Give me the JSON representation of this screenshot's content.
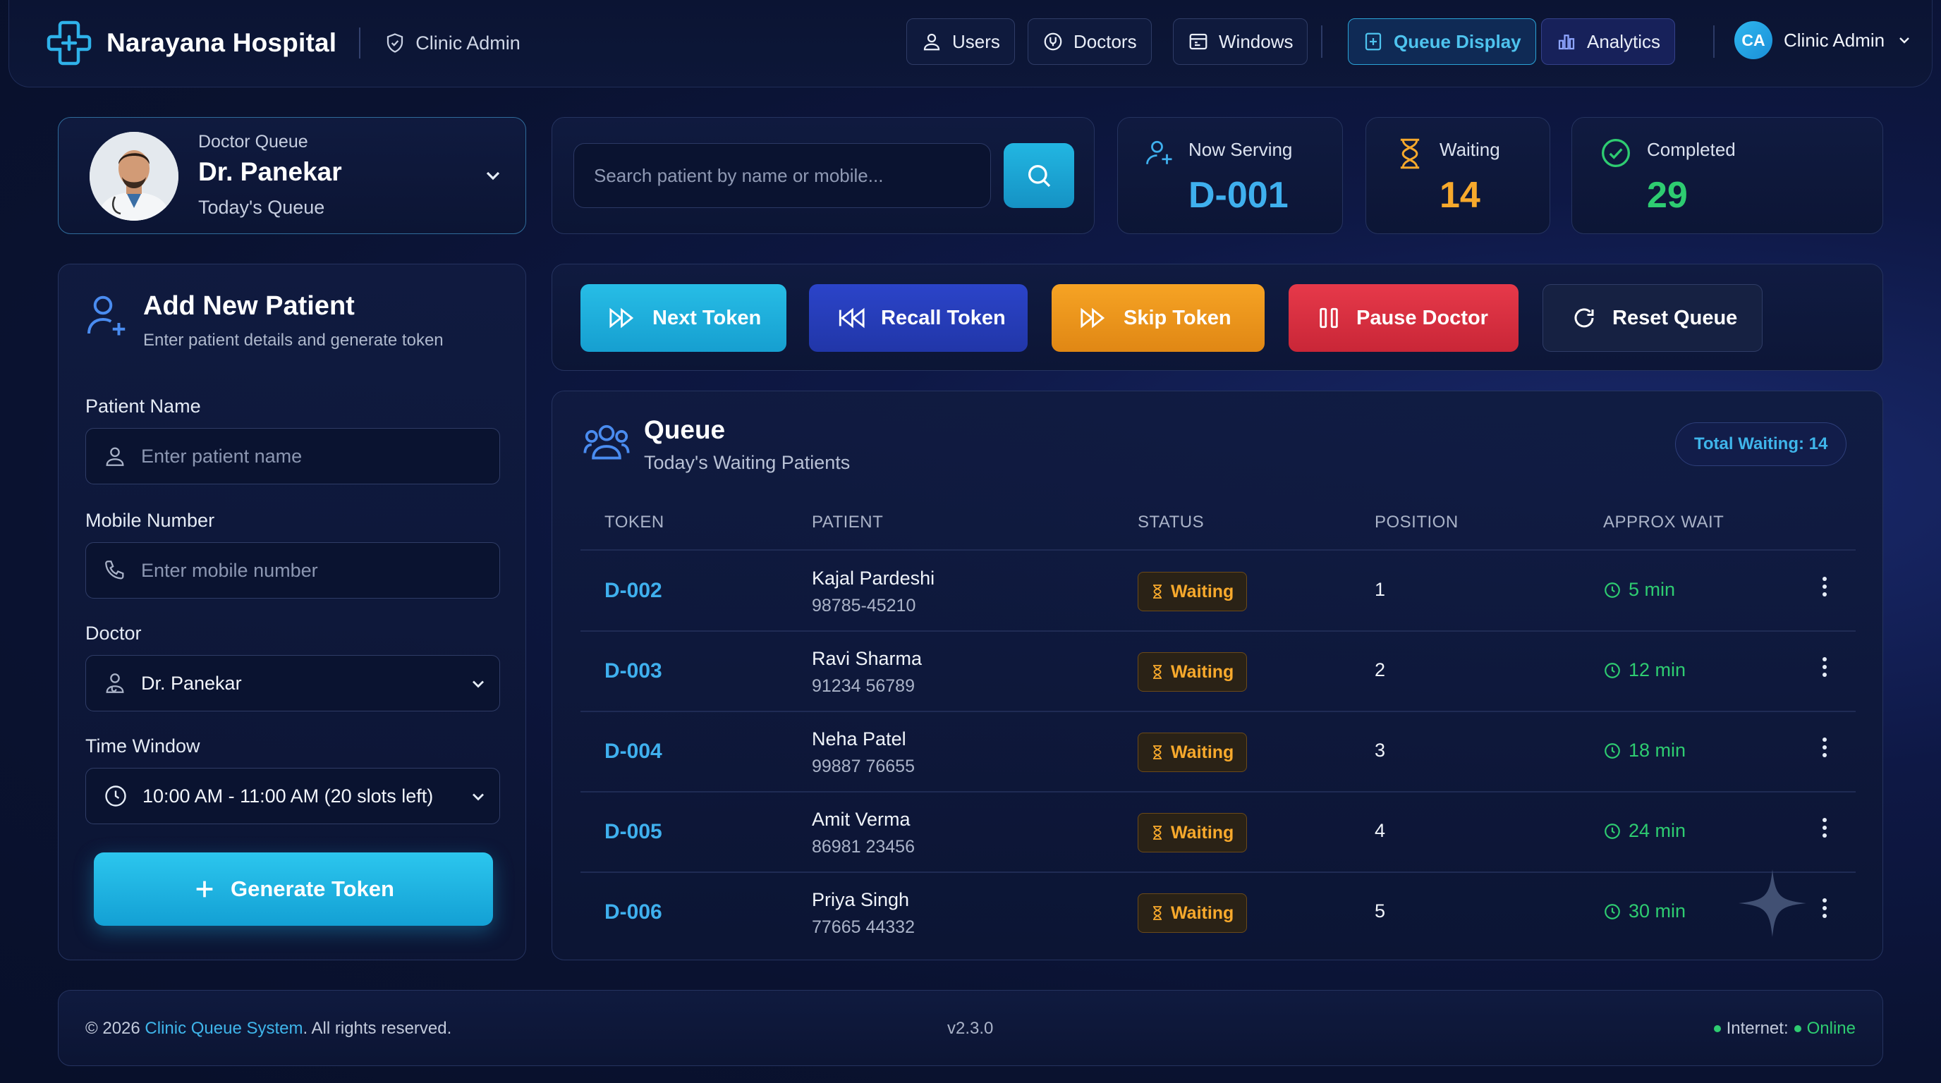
{
  "header": {
    "brand": "Narayana Hospital",
    "role": "Clinic Admin",
    "nav": [
      {
        "label": "Users",
        "icon": "user-icon"
      },
      {
        "label": "Doctors",
        "icon": "stethoscope-icon"
      },
      {
        "label": "Windows",
        "icon": "window-icon"
      },
      {
        "label": "Queue Display",
        "icon": "display-icon",
        "active": true
      },
      {
        "label": "Analytics",
        "icon": "bar-chart-icon"
      }
    ],
    "user": {
      "initials": "CA",
      "name": "Clinic Admin"
    }
  },
  "doctor_card": {
    "small": "Doctor Queue",
    "name": "Dr. Panekar",
    "sub": "Today's Queue"
  },
  "search": {
    "placeholder": "Search patient by name or mobile..."
  },
  "stats": {
    "now_serving": {
      "label": "Now Serving",
      "value": "D-001",
      "color": "#3fb0ee"
    },
    "waiting": {
      "label": "Waiting",
      "value": "14",
      "color": "#f7a92c"
    },
    "completed": {
      "label": "Completed",
      "value": "29",
      "color": "#2ecc71"
    }
  },
  "form": {
    "title": "Add New Patient",
    "subtitle": "Enter patient details and generate token",
    "name_label": "Patient Name",
    "name_placeholder": "Enter patient name",
    "mobile_label": "Mobile Number",
    "mobile_placeholder": "Enter mobile number",
    "doctor_label": "Doctor",
    "doctor_value": "Dr. Panekar",
    "time_label": "Time Window",
    "time_value": "10:00 AM - 11:00 AM (20 slots left)",
    "generate_label": "Generate Token"
  },
  "actions": {
    "next": "Next Token",
    "recall": "Recall Token",
    "skip": "Skip Token",
    "pause": "Pause Doctor",
    "reset": "Reset Queue"
  },
  "queue": {
    "title": "Queue",
    "subtitle": "Today's Waiting Patients",
    "total": "Total Waiting: 14",
    "headers": {
      "token": "TOKEN",
      "patient": "PATIENT",
      "status": "STATUS",
      "position": "POSITION",
      "wait": "APPROX WAIT"
    },
    "rows": [
      {
        "token": "D-002",
        "name": "Kajal Pardeshi",
        "mobile": "98785-45210",
        "status": "Waiting",
        "position": "1",
        "wait": "5 min"
      },
      {
        "token": "D-003",
        "name": "Ravi Sharma",
        "mobile": "91234 56789",
        "status": "Waiting",
        "position": "2",
        "wait": "12 min"
      },
      {
        "token": "D-004",
        "name": "Neha Patel",
        "mobile": "99887 76655",
        "status": "Waiting",
        "position": "3",
        "wait": "18 min"
      },
      {
        "token": "D-005",
        "name": "Amit Verma",
        "mobile": "86981 23456",
        "status": "Waiting",
        "position": "4",
        "wait": "24 min"
      },
      {
        "token": "D-006",
        "name": "Priya Singh",
        "mobile": "77665 44332",
        "status": "Waiting",
        "position": "5",
        "wait": "30 min"
      }
    ]
  },
  "footer": {
    "copy_prefix": "© 2026 ",
    "copy_link": "Clinic Queue System",
    "copy_suffix": ". All rights reserved.",
    "version": "v2.3.0",
    "net_label": "Internet:",
    "net_status": "Online"
  }
}
